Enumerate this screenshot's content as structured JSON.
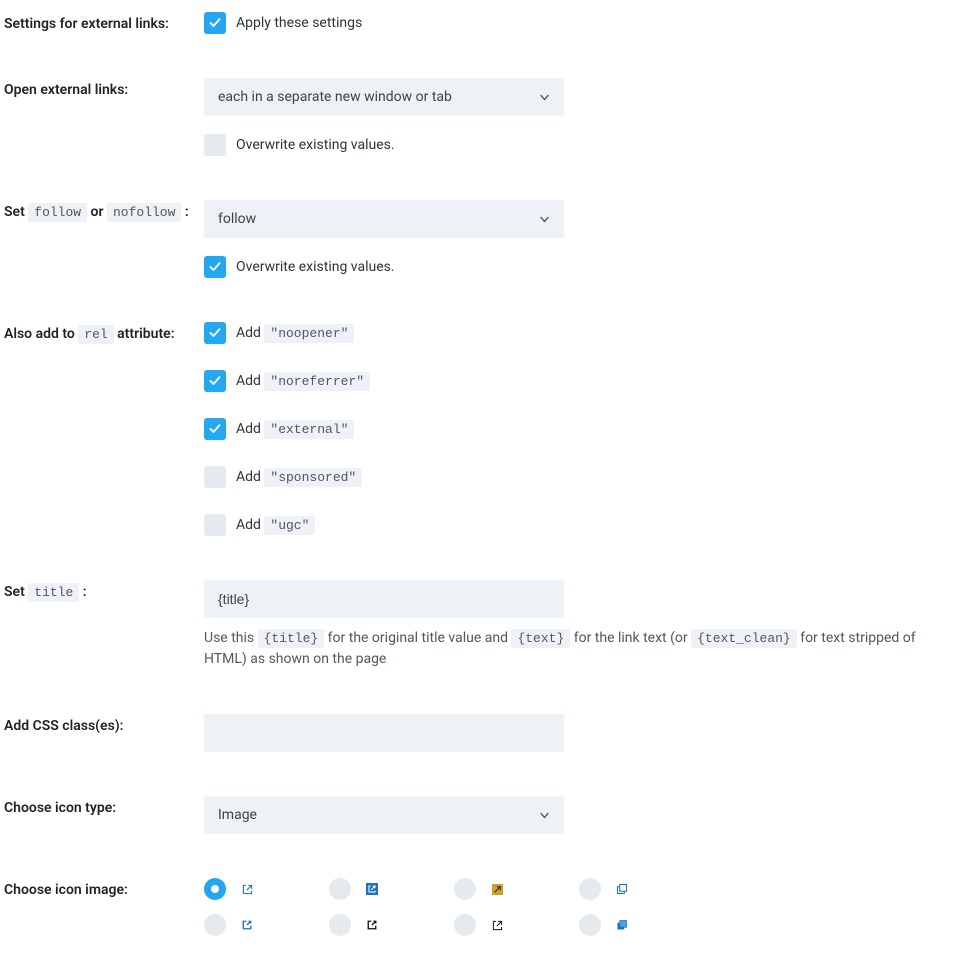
{
  "settings_links_label": "Settings for external links:",
  "apply_settings_label": "Apply these settings",
  "open_external_label": "Open external links:",
  "open_external_value": "each in a separate new window or tab",
  "overwrite_label": "Overwrite existing values.",
  "set_follow_prefix": "Set ",
  "follow_code": "follow",
  "or_text": " or ",
  "nofollow_code": "nofollow",
  "colon": " :",
  "follow_value": "follow",
  "rel_prefix": "Also add to ",
  "rel_code": "rel",
  "rel_suffix": " attribute:",
  "add_text": "Add ",
  "rel_opts": [
    {
      "code": "\"noopener\"",
      "checked": true
    },
    {
      "code": "\"noreferrer\"",
      "checked": true
    },
    {
      "code": "\"external\"",
      "checked": true
    },
    {
      "code": "\"sponsored\"",
      "checked": false
    },
    {
      "code": "\"ugc\"",
      "checked": false
    }
  ],
  "set_title_prefix": "Set ",
  "title_code": "title",
  "title_value": "{title}",
  "help_use_this": "Use this ",
  "help_title_code": "{title}",
  "help_mid1": " for the original title value and ",
  "help_text_code": "{text}",
  "help_mid2": " for the link text (or ",
  "help_clean_code": "{text_clean}",
  "help_end": " for text stripped of HTML) as shown on the page",
  "css_class_label": "Add CSS class(es):",
  "css_class_value": "",
  "icon_type_label": "Choose icon type:",
  "icon_type_value": "Image",
  "icon_image_label": "Choose icon image:"
}
